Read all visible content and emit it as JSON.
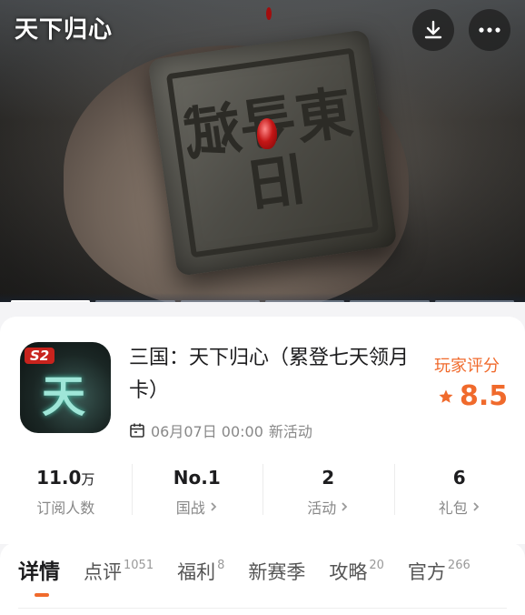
{
  "hero": {
    "logo_text": "天下归心",
    "seal_text": "東寻斌旧",
    "slides_total": 6,
    "active_slide": 1
  },
  "actions": {
    "download_icon": "download-icon",
    "more_icon": "more-dots-icon"
  },
  "app": {
    "icon_badge": "S2",
    "icon_glyph": "天下",
    "title": "三国：天下归心（累登七天领月卡）",
    "date": "06月07日 00:00",
    "event_label": "新活动",
    "rating_label": "玩家评分",
    "rating_value": "8.5"
  },
  "stats": [
    {
      "value": "11.0",
      "unit": "万",
      "label": "订阅人数"
    },
    {
      "value": "No.1",
      "unit": "",
      "label": "国战"
    },
    {
      "value": "2",
      "unit": "",
      "label": "活动"
    },
    {
      "value": "6",
      "unit": "",
      "label": "礼包"
    }
  ],
  "tabs": [
    {
      "label": "详情",
      "count": ""
    },
    {
      "label": "点评",
      "count": "1051"
    },
    {
      "label": "福利",
      "count": "8"
    },
    {
      "label": "新赛季",
      "count": ""
    },
    {
      "label": "攻略",
      "count": "20"
    },
    {
      "label": "官方",
      "count": "266"
    }
  ],
  "colors": {
    "accent": "#f06a2c",
    "badge": "#c8231d"
  }
}
